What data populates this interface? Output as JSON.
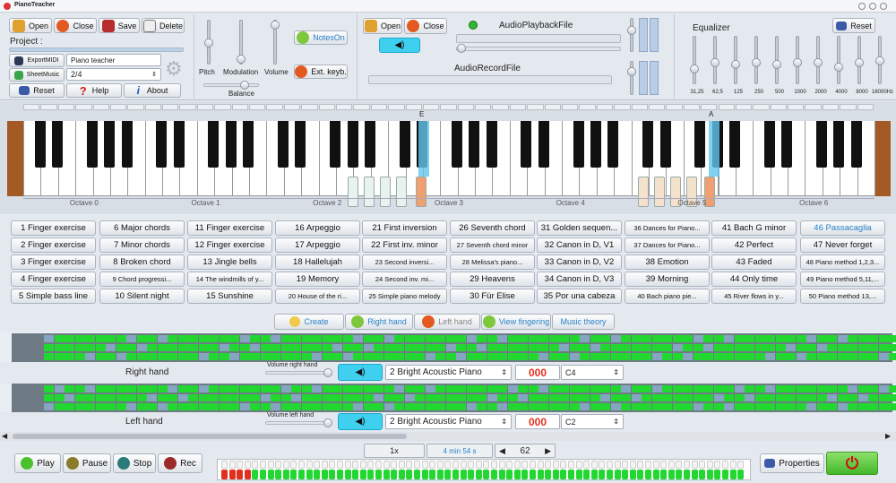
{
  "window": {
    "title": "PianoTeacher"
  },
  "file": {
    "open": "Open",
    "close": "Close",
    "save": "Save",
    "delete": "Delete",
    "project_label": "Project :"
  },
  "export": {
    "export_midi": "ExportMIDI",
    "project_name": "Piano teacher",
    "sheet_music": "SheetMusic",
    "time_signature": "2/4"
  },
  "help": {
    "reset": "Reset",
    "help": "Help",
    "about": "About"
  },
  "mixer": {
    "pitch": "Pitch",
    "modulation": "Modulation",
    "volume": "Volume",
    "balance": "Balance"
  },
  "midi": {
    "notes_on": "NotesOn",
    "ext_keyboard": "Ext. keyb."
  },
  "audio": {
    "open": "Open",
    "close": "Close",
    "playback_label": "AudioPlaybackFile",
    "record_label": "AudioRecordFile"
  },
  "equalizer": {
    "title": "Equalizer",
    "reset": "Reset",
    "bands": [
      "31,25",
      "62,5",
      "125",
      "250",
      "500",
      "1000",
      "2000",
      "4000",
      "8000",
      "16000Hz"
    ]
  },
  "keyboard": {
    "marker_e": "E",
    "marker_a": "A",
    "octaves": [
      "Octave 0",
      "Octave 1",
      "Octave 2",
      "Octave 3",
      "Octave 4",
      "Octave 5",
      "Octave 6"
    ]
  },
  "songs": [
    [
      "1 Finger exercise",
      "6 Major chords",
      "11 Finger exercise",
      "16 Arpeggio",
      "21 First inversion",
      "26 Seventh chord",
      "31 Golden sequen...",
      "36 Dances for Piano...",
      "41 Bach G minor",
      "46 Passacaglia"
    ],
    [
      "2 Finger exercise",
      "7 Minor chords",
      "12 Finger exercise",
      "17 Arpeggio",
      "22 First inv. minor",
      "27 Seventh chord minor",
      "32 Canon in D, V1",
      "37 Dances for Piano...",
      "42 Perfect",
      "47 Never forget"
    ],
    [
      "3 Finger exercise",
      "8 Broken chord",
      "13 Jingle bells",
      "18 Hallelujah",
      "23 Second inversi...",
      "28 Melissa's piano...",
      "33 Canon in D, V2",
      "38 Emotion",
      "43 Faded",
      "48 Piano method 1,2,3..."
    ],
    [
      "4 Finger exercise",
      "9 Chord progressi...",
      "14 The windmills of y...",
      "19 Memory",
      "24 Second inv. mi...",
      "29 Heavens",
      "34 Canon in D, V3",
      "39 Morning",
      "44 Only time",
      "49 Piano method 5,11,..."
    ],
    [
      "5 Simple bass line",
      "10 Silent night",
      "15 Sunshine",
      "20 House of the ri...",
      "25 Simple piano melody",
      "30 Für Elise",
      "35 Por una cabeza",
      "40 Bach piano pie...",
      "45 River flows in y...",
      "50 Piano method 13,..."
    ]
  ],
  "lesson": {
    "create": "Create",
    "right_hand": "Right hand",
    "left_hand": "Left hand",
    "view_fingering": "View fingering",
    "music_theory": "Music theory"
  },
  "tracks": [
    {
      "label": "Right hand",
      "volume_label": "Volume right hand",
      "instrument": "2 Bright Acoustic Piano",
      "counter": "000",
      "note": "C4"
    },
    {
      "label": "Left hand",
      "volume_label": "Volume left hand",
      "instrument": "2 Bright Acoustic Piano",
      "counter": "000",
      "note": "C2"
    }
  ],
  "transport": {
    "play": "Play",
    "pause": "Pause",
    "stop": "Stop",
    "rec": "Rec",
    "speed": "1x",
    "duration": "4 min 54 s",
    "measure": "62",
    "properties": "Properties"
  },
  "colors": {
    "accent_blue": "#26c6ea",
    "green": "#22d830",
    "highlight_orange": "#f0a070",
    "record_red": "#e03020"
  }
}
